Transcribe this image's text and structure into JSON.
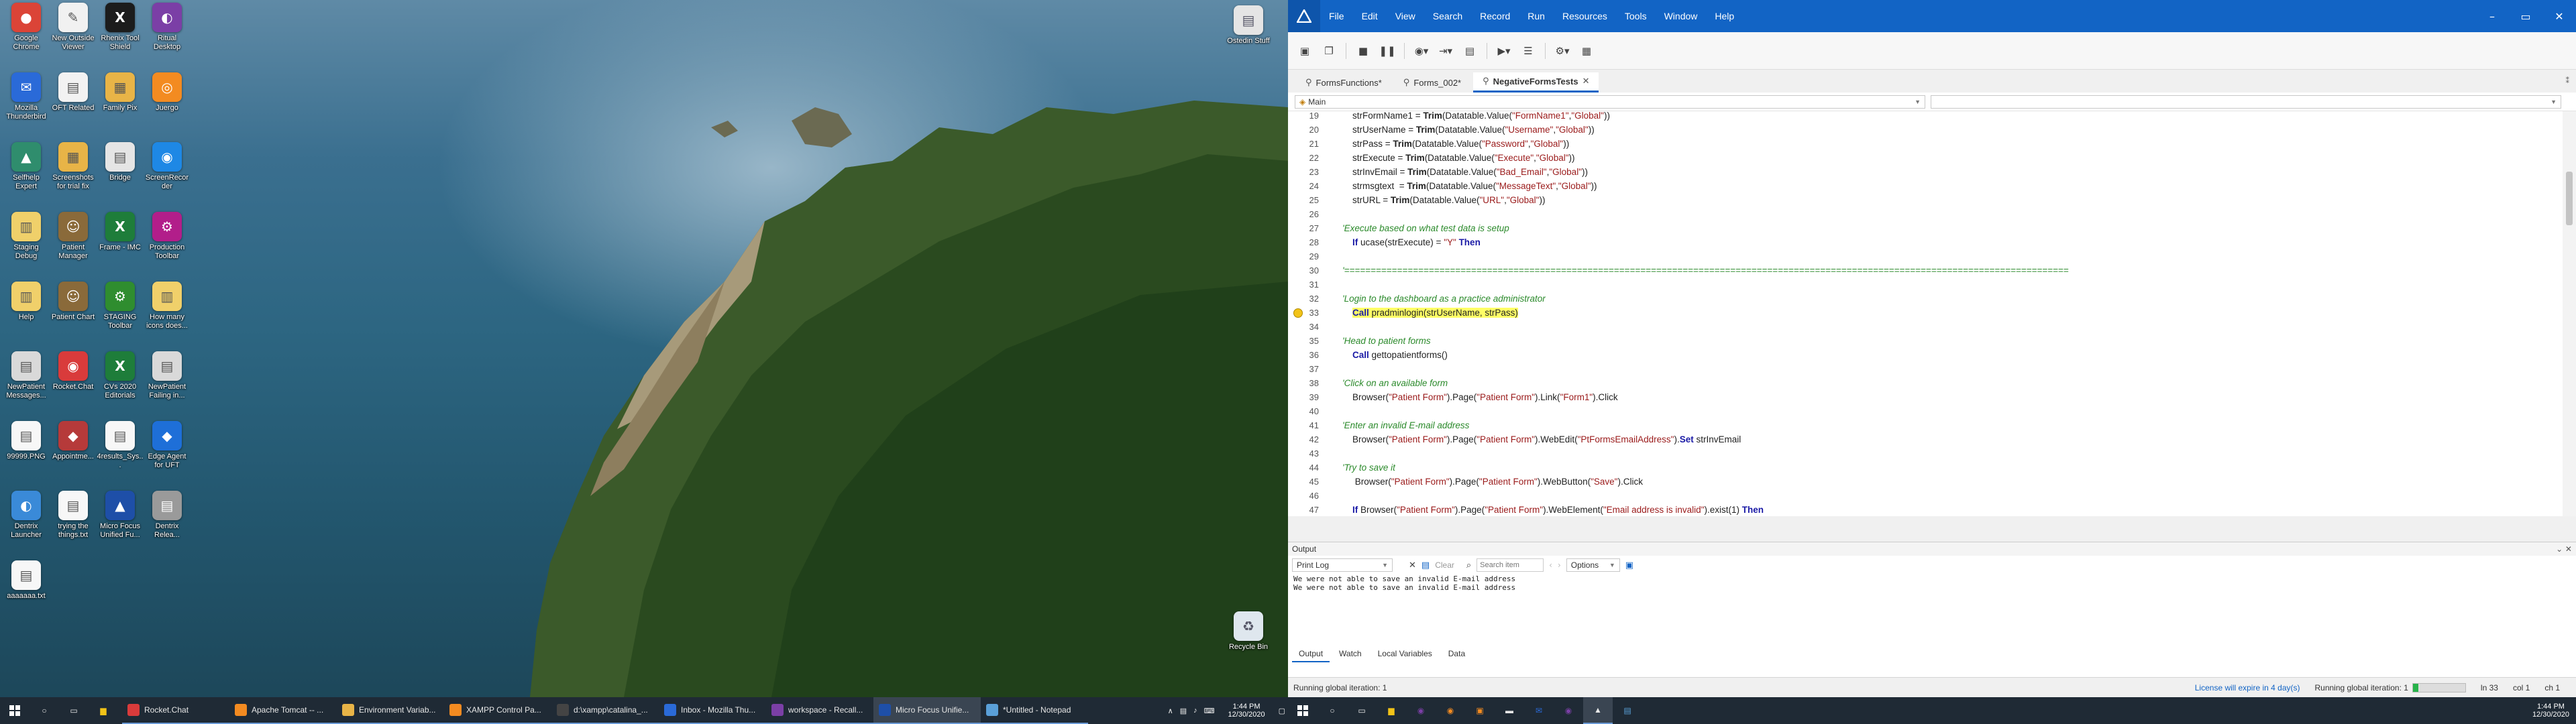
{
  "desktop": {
    "icons": [
      {
        "label": "Google Chrome",
        "color": "#db4437",
        "glyph": "●"
      },
      {
        "label": "New Outside Viewer",
        "color": "#f1f1f1",
        "glyph": "✎"
      },
      {
        "label": "Rhenix Tool Shield",
        "color": "#1c1c1c",
        "glyph": "X"
      },
      {
        "label": "Ritual Desktop",
        "color": "#7b3fa6",
        "glyph": "◐"
      },
      {
        "label": "Mozilla Thunderbird",
        "color": "#2a6ad8",
        "glyph": "✉"
      },
      {
        "label": "OFT Related",
        "color": "#f2f2f2",
        "glyph": "▤"
      },
      {
        "label": "Family Pix",
        "color": "#e8b447",
        "glyph": "▦"
      },
      {
        "label": "Juergo",
        "color": "#f38b21",
        "glyph": "◎"
      },
      {
        "label": "Selfhelp Expert",
        "color": "#2f8d6d",
        "glyph": "▲"
      },
      {
        "label": "Screenshots for trial fix",
        "color": "#e8b447",
        "glyph": "▦"
      },
      {
        "label": "Bridge",
        "color": "#e5e5e5",
        "glyph": "▤"
      },
      {
        "label": "ScreenRecorder",
        "color": "#1e88e5",
        "glyph": "◉"
      },
      {
        "label": "Staging Debug",
        "color": "#f0d06a",
        "glyph": "▥"
      },
      {
        "label": "Patient Manager",
        "color": "#8a6a3a",
        "glyph": "☺"
      },
      {
        "label": "Frame - IMC",
        "color": "#1e7d3a",
        "glyph": "X"
      },
      {
        "label": "Production Toolbar",
        "color": "#b21e8a",
        "glyph": "⚙"
      },
      {
        "label": "Help",
        "color": "#f0d06a",
        "glyph": "▥"
      },
      {
        "label": "Patient Chart",
        "color": "#8a6a3a",
        "glyph": "☺"
      },
      {
        "label": "STAGING Toolbar",
        "color": "#2f8d2f",
        "glyph": "⚙"
      },
      {
        "label": "How many icons does...",
        "color": "#f0d06a",
        "glyph": "▥"
      },
      {
        "label": "NewPatient Messages...",
        "color": "#d9d9d9",
        "glyph": "▤"
      },
      {
        "label": "Rocket.Chat",
        "color": "#d93b3b",
        "glyph": "◉"
      },
      {
        "label": "CVs 2020 Editorials",
        "color": "#1e7d3a",
        "glyph": "X"
      },
      {
        "label": "NewPatient Failing in...",
        "color": "#d9d9d9",
        "glyph": "▤"
      },
      {
        "label": "99999.PNG",
        "color": "#f7f7f7",
        "glyph": "▤"
      },
      {
        "label": "Appointme...",
        "color": "#b63a3a",
        "glyph": "◆"
      },
      {
        "label": "4results_Sys...",
        "color": "#f7f7f7",
        "glyph": "▤"
      },
      {
        "label": "Edge Agent for UFT",
        "color": "#1e6fd8",
        "glyph": "◆"
      },
      {
        "label": "Dentrix Launcher",
        "color": "#3a8ad8",
        "glyph": "◐"
      },
      {
        "label": "trying the things.txt",
        "color": "#f7f7f7",
        "glyph": "▤"
      },
      {
        "label": "Micro Focus Unified Fu...",
        "color": "#1e4fa8",
        "glyph": "▲"
      },
      {
        "label": "Dentrix Relea...",
        "color": "#9a9a9a",
        "glyph": "▤"
      },
      {
        "label": "aaaaaaa.txt",
        "color": "#f7f7f7",
        "glyph": "▤"
      }
    ],
    "right_icons": [
      {
        "label": "Ostedin Stuff",
        "color": "#e5e5e5",
        "glyph": "▤"
      },
      {
        "label": "Recycle Bin",
        "color": "#dfe7ee",
        "glyph": "♻"
      }
    ]
  },
  "taskbar_left": {
    "windows": [
      {
        "label": "Rocket.Chat",
        "color": "#d93b3b"
      },
      {
        "label": "Apache Tomcat -- ...",
        "color": "#f38b21"
      },
      {
        "label": "Environment Variab...",
        "color": "#e8b447"
      },
      {
        "label": "XAMPP Control Pa...",
        "color": "#f38b21"
      },
      {
        "label": "d:\\xampp\\catalina_...",
        "color": "#444444"
      },
      {
        "label": "Inbox - Mozilla Thu...",
        "color": "#2a6ad8"
      },
      {
        "label": "workspace - Recall...",
        "color": "#7b3fa6"
      },
      {
        "label": "Micro Focus Unifie...",
        "color": "#1e4fa8"
      },
      {
        "label": "*Untitled - Notepad",
        "color": "#5aa0d8"
      }
    ],
    "time": "1:44 PM",
    "date": "12/30/2020"
  },
  "uft": {
    "menus": [
      "File",
      "Edit",
      "View",
      "Search",
      "Record",
      "Run",
      "Resources",
      "Tools",
      "Window",
      "Help"
    ],
    "tabs": [
      {
        "label": "FormsFunctions*",
        "active": false
      },
      {
        "label": "Forms_002*",
        "active": false
      },
      {
        "label": "NegativeFormsTests",
        "active": true
      }
    ],
    "dropdown_left": "Main",
    "dropdown_right": "",
    "code_lines": [
      {
        "n": "19",
        "html": "        strFormName1 = <b>Trim</b>(Datatable.Value(<span class='str'>\"FormName1\"</span>,<span class='str'>\"Global\"</span>))"
      },
      {
        "n": "20",
        "html": "        strUserName = <b>Trim</b>(Datatable.Value(<span class='str'>\"Username\"</span>,<span class='str'>\"Global\"</span>))"
      },
      {
        "n": "21",
        "html": "        strPass = <b>Trim</b>(Datatable.Value(<span class='str'>\"Password\"</span>,<span class='str'>\"Global\"</span>))"
      },
      {
        "n": "22",
        "html": "        strExecute = <b>Trim</b>(Datatable.Value(<span class='str'>\"Execute\"</span>,<span class='str'>\"Global\"</span>))"
      },
      {
        "n": "23",
        "html": "        strInvEmail = <b>Trim</b>(Datatable.Value(<span class='str'>\"Bad_Email\"</span>,<span class='str'>\"Global\"</span>))"
      },
      {
        "n": "24",
        "html": "        strmsgtext  = <b>Trim</b>(Datatable.Value(<span class='str'>\"MessageText\"</span>,<span class='str'>\"Global\"</span>))"
      },
      {
        "n": "25",
        "html": "        strURL = <b>Trim</b>(Datatable.Value(<span class='str'>\"URL\"</span>,<span class='str'>\"Global\"</span>))"
      },
      {
        "n": "26",
        "html": ""
      },
      {
        "n": "27",
        "html": "    <span class='cmt'>'Execute based on what test data is setup</span>"
      },
      {
        "n": "28",
        "html": "        <span class='kw'>If</span> ucase(strExecute) = <span class='str'>\"Y\"</span> <span class='kw'>Then</span>"
      },
      {
        "n": "29",
        "html": ""
      },
      {
        "n": "30",
        "html": "    <span class='cmt'>'=========================================================================================================================================</span>"
      },
      {
        "n": "31",
        "html": ""
      },
      {
        "n": "32",
        "html": "    <span class='cmt'>'Login to the dashboard as a practice administrator</span>"
      },
      {
        "n": "33",
        "html": "        <span class='hlt'><span class='kw'>Call</span> pradminlogin(strUserName, strPass)</span>",
        "hl": true
      },
      {
        "n": "34",
        "html": ""
      },
      {
        "n": "35",
        "html": "    <span class='cmt'>'Head to patient forms</span>"
      },
      {
        "n": "36",
        "html": "        <span class='kw'>Call</span> gettopatientforms()"
      },
      {
        "n": "37",
        "html": ""
      },
      {
        "n": "38",
        "html": "    <span class='cmt'>'Click on an available form</span>"
      },
      {
        "n": "39",
        "html": "        Browser(<span class='str'>\"Patient Form\"</span>).Page(<span class='str'>\"Patient Form\"</span>).Link(<span class='str'>\"Form1\"</span>).Click"
      },
      {
        "n": "40",
        "html": ""
      },
      {
        "n": "41",
        "html": "    <span class='cmt'>'Enter an invalid E-mail address</span>"
      },
      {
        "n": "42",
        "html": "        Browser(<span class='str'>\"Patient Form\"</span>).Page(<span class='str'>\"Patient Form\"</span>).WebEdit(<span class='str'>\"PtFormsEmailAddress\"</span>).<span class='kw'>Set</span> strInvEmail"
      },
      {
        "n": "43",
        "html": ""
      },
      {
        "n": "44",
        "html": "    <span class='cmt'>'Try to save it</span>"
      },
      {
        "n": "45",
        "html": "         Browser(<span class='str'>\"Patient Form\"</span>).Page(<span class='str'>\"Patient Form\"</span>).WebButton(<span class='str'>\"Save\"</span>).Click"
      },
      {
        "n": "46",
        "html": ""
      },
      {
        "n": "47",
        "html": "        <span class='kw'>If</span> Browser(<span class='str'>\"Patient Form\"</span>).Page(<span class='str'>\"Patient Form\"</span>).WebElement(<span class='str'>\"Email address is invalid\"</span>).exist(1) <span class='kw'>Then</span>"
      }
    ],
    "output": {
      "title": "Output",
      "select": "Print Log",
      "clear_label": "Clear",
      "search_placeholder": "Search item",
      "options_label": "Options",
      "lines": [
        "We were not able to save an invalid E-mail address",
        "We were not able to save an invalid E-mail address"
      ]
    },
    "bottom_tabs": [
      "Output",
      "Watch",
      "Local Variables",
      "Data"
    ],
    "status": {
      "left": "Running global iteration: 1",
      "license": "License will expire in 4 day(s)",
      "running": "Running global iteration: 1",
      "ln": "ln 33",
      "col": "col 1",
      "ch": "ch 1"
    }
  },
  "taskbar_right": {
    "time": "1:44 PM",
    "date": "12/30/2020"
  }
}
